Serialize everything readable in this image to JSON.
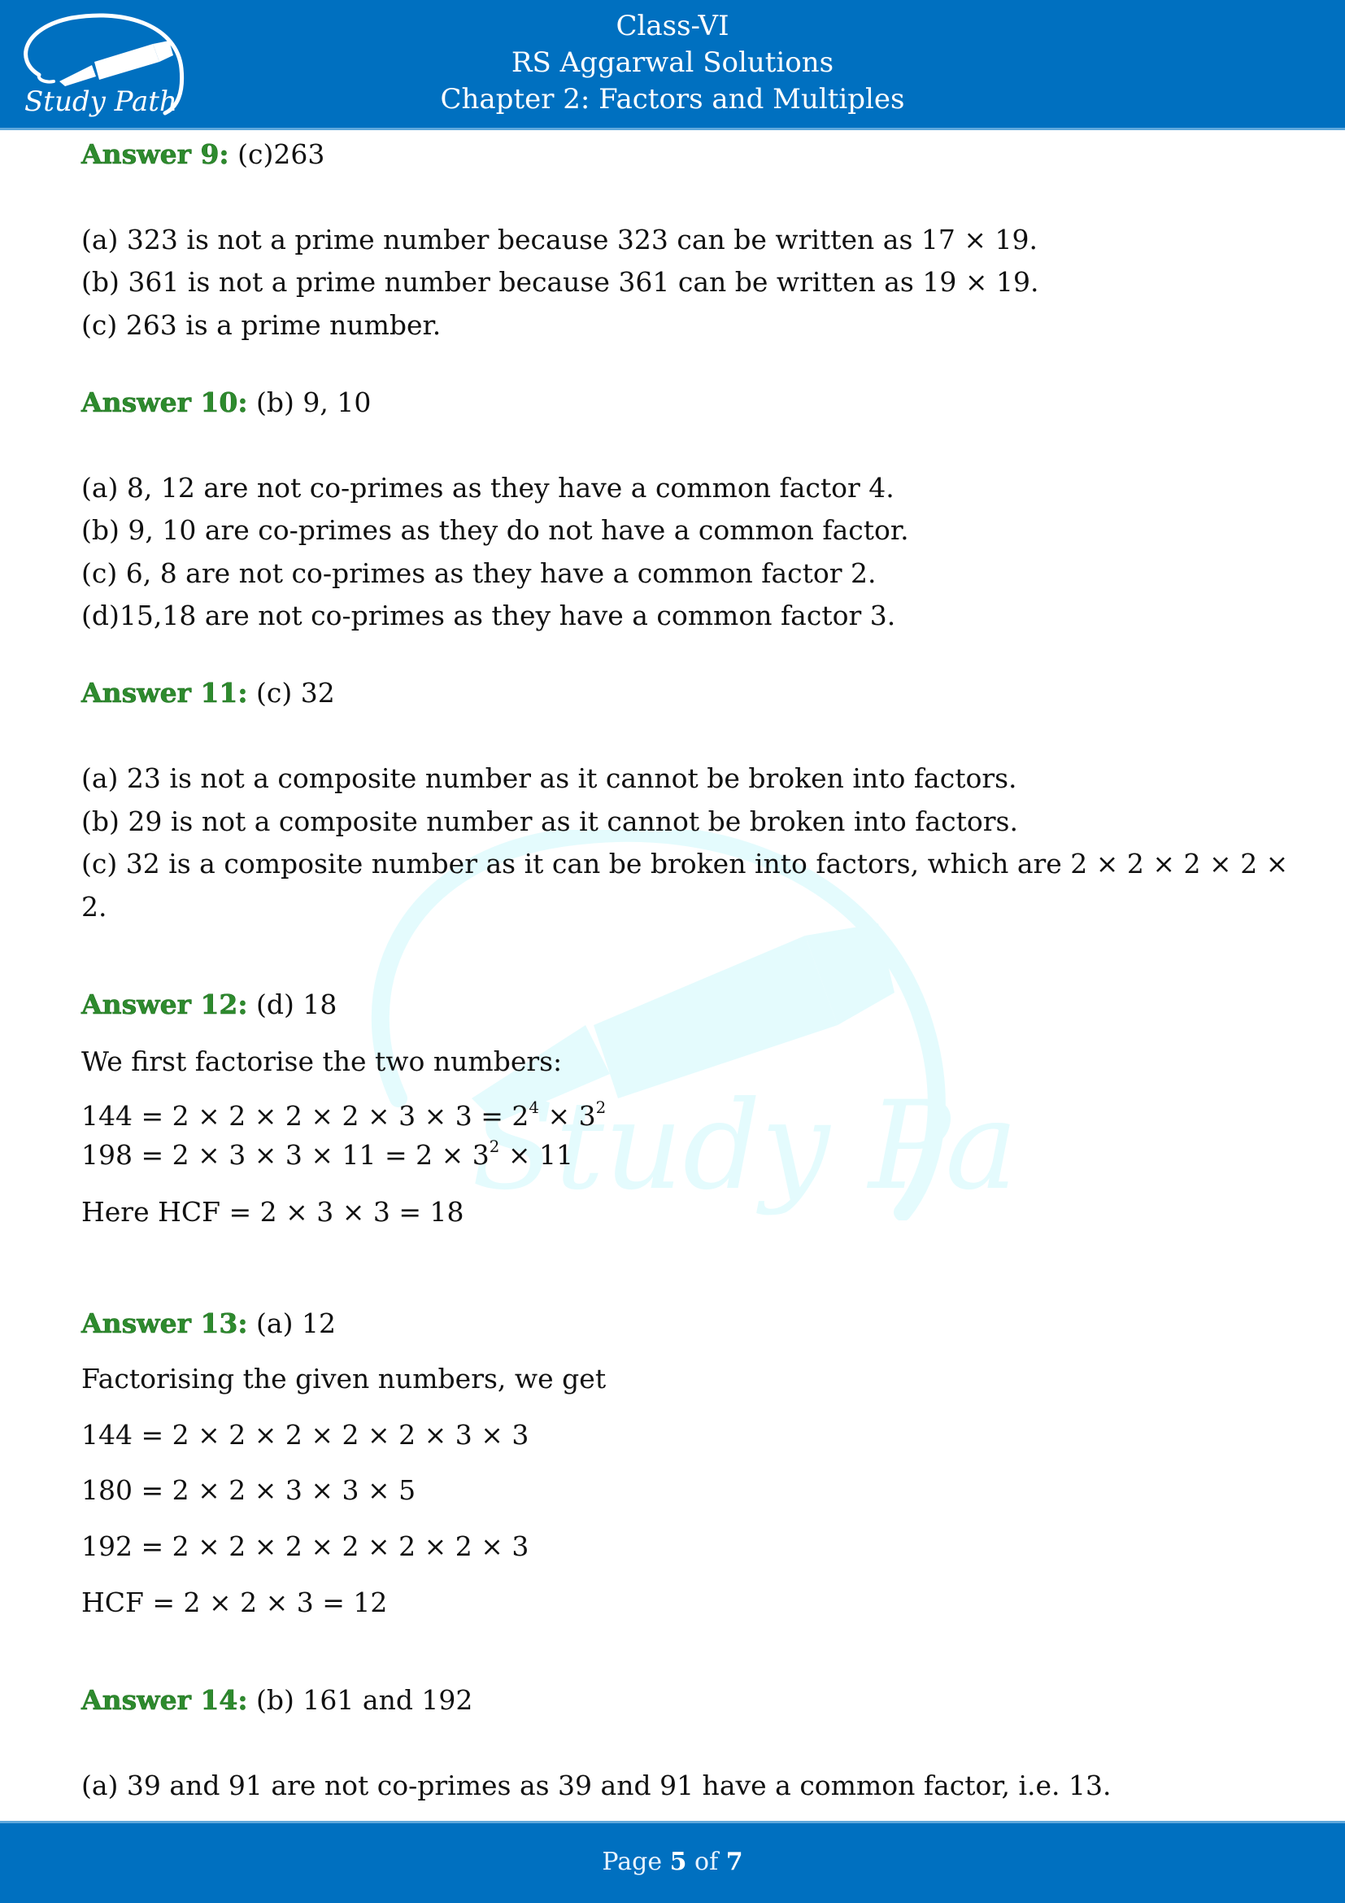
{
  "header": {
    "logo_text": "Study Path",
    "line1": "Class-VI",
    "line2": "RS Aggarwal Solutions",
    "line3": "Chapter 2: Factors and Multiples"
  },
  "watermark": {
    "text": "Study Path"
  },
  "answers": [
    {
      "label": "Answer 9:",
      "choice": " (c)263",
      "lines": [
        "(a) 323 is not a prime number because 323 can be written as 17 × 19.",
        "(b) 361 is not a prime number because 361 can be written as 19 × 19.",
        "(c) 263 is a prime number."
      ]
    },
    {
      "label": "Answer 10:",
      "choice": " (b) 9, 10",
      "lines": [
        "(a) 8, 12 are not co-primes as they have a common factor 4.",
        "(b) 9, 10 are co-primes as they do not have a common factor.",
        "(c) 6, 8 are not co-primes as they have a common factor 2.",
        "(d)15,18 are not co-primes as they have a common factor 3."
      ]
    },
    {
      "label": "Answer 11:",
      "choice": " (c) 32",
      "lines": [
        "(a) 23 is not a composite number as it cannot be broken into factors.",
        "(b) 29 is not a composite number as it cannot be broken into factors.",
        "(c) 32 is a composite number as it can be broken into factors, which are 2 × 2 × 2 × 2 ×",
        "2."
      ]
    },
    {
      "label": "Answer 12:",
      "choice": " (d) 18",
      "intro": "We first factorise the two numbers:",
      "eq1": {
        "lhs": "144 = 2 × 2 × 2 × 2 × 3 × 3 = 2",
        "exp1": "4",
        "mid": " × 3",
        "exp2": "2"
      },
      "eq2": {
        "lhs": "198 = 2 × 3 × 3 × 11 = 2 × 3",
        "exp1": "2",
        "rest": " × 11"
      },
      "result": "Here HCF = 2 × 3 × 3 = 18"
    },
    {
      "label": "Answer 13:",
      "choice": " (a) 12",
      "intro": "Factorising the given numbers, we get",
      "lines": [
        "144 = 2 × 2 × 2 × 2 × 2 × 3 × 3",
        "180 = 2 × 2 × 3 × 3 × 5",
        "192 = 2 × 2 × 2 × 2 × 2 × 2 × 3",
        "HCF = 2 × 2 × 3 = 12"
      ]
    },
    {
      "label": "Answer 14:",
      "choice": " (b) 161 and 192",
      "lines": [
        "(a) 39 and 91 are not co-primes as 39 and 91 have a common factor, i.e. 13."
      ]
    }
  ],
  "footer": {
    "prefix": "Page ",
    "current": "5",
    "of": " of ",
    "total": "7"
  },
  "colors": {
    "brand_blue": "#0070c0",
    "answer_green": "#2e8b2e",
    "watermark_cyan": "#e4fbfd"
  }
}
